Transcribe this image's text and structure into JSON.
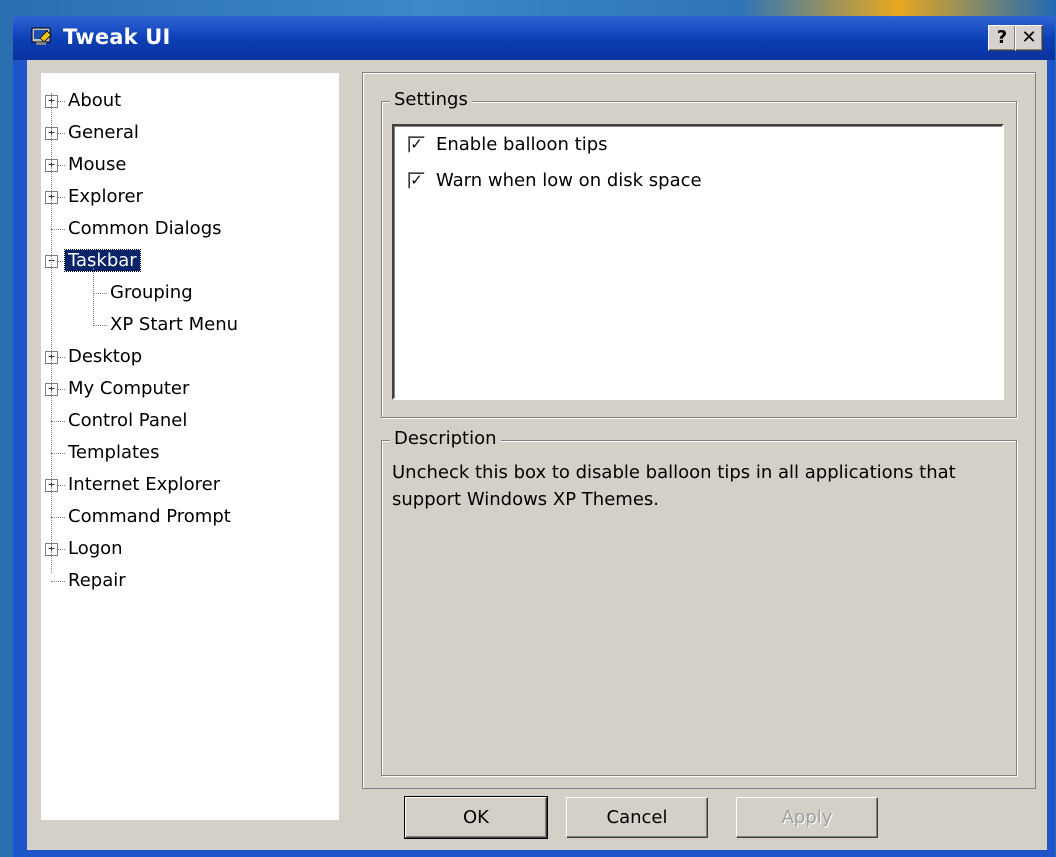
{
  "window": {
    "title": "Tweak UI"
  },
  "titlebar_buttons": {
    "help": "?",
    "close": "✕"
  },
  "tree": [
    {
      "label": "About",
      "expander": "+",
      "level": 0
    },
    {
      "label": "General",
      "expander": "+",
      "level": 0
    },
    {
      "label": "Mouse",
      "expander": "+",
      "level": 0
    },
    {
      "label": "Explorer",
      "expander": "+",
      "level": 0
    },
    {
      "label": "Common Dialogs",
      "expander": "",
      "level": 0
    },
    {
      "label": "Taskbar",
      "expander": "−",
      "level": 0,
      "selected": true
    },
    {
      "label": "Grouping",
      "expander": "",
      "level": 1
    },
    {
      "label": "XP Start Menu",
      "expander": "",
      "level": 1
    },
    {
      "label": "Desktop",
      "expander": "+",
      "level": 0
    },
    {
      "label": "My Computer",
      "expander": "+",
      "level": 0
    },
    {
      "label": "Control Panel",
      "expander": "",
      "level": 0
    },
    {
      "label": "Templates",
      "expander": "",
      "level": 0
    },
    {
      "label": "Internet Explorer",
      "expander": "+",
      "level": 0
    },
    {
      "label": "Command Prompt",
      "expander": "",
      "level": 0
    },
    {
      "label": "Logon",
      "expander": "+",
      "level": 0
    },
    {
      "label": "Repair",
      "expander": "",
      "level": 0
    }
  ],
  "settings": {
    "title": "Settings",
    "items": [
      {
        "label": "Enable balloon tips",
        "checked": true
      },
      {
        "label": "Warn when low on disk space",
        "checked": true
      }
    ]
  },
  "description": {
    "title": "Description",
    "text": "Uncheck this box to disable balloon tips in all applications that support Windows XP Themes."
  },
  "buttons": {
    "ok": "OK",
    "cancel": "Cancel",
    "apply": "Apply"
  }
}
